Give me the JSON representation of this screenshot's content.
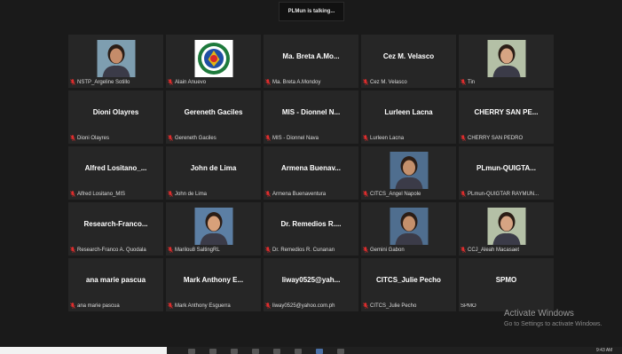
{
  "banner": "PLMun is talking...",
  "tiles": [
    {
      "name": "",
      "label": "NSTP_Argeline Sotillo",
      "avatar": "person-photo"
    },
    {
      "name": "",
      "label": "Alain Anuevo",
      "avatar": "seal-logo"
    },
    {
      "name": "Ma. Breta A.Mo...",
      "label": "Ma. Breta A.Mondoy",
      "avatar": ""
    },
    {
      "name": "Cez M. Velasco",
      "label": "Cez M. Velasco",
      "avatar": ""
    },
    {
      "name": "",
      "label": "Tin",
      "avatar": "person-photo"
    },
    {
      "name": "Dioni Olayres",
      "label": "Dioni Olayres",
      "avatar": ""
    },
    {
      "name": "Gereneth Gaciles",
      "label": "Gereneth Gaciles",
      "avatar": ""
    },
    {
      "name": "MIS - Dionnel N...",
      "label": "MIS - Dionnel Nava",
      "avatar": ""
    },
    {
      "name": "Lurleen Lacna",
      "label": "Lurleen Lacna",
      "avatar": ""
    },
    {
      "name": "CHERRY SAN PE...",
      "label": "CHERRY SAN PEDRO",
      "avatar": ""
    },
    {
      "name": "Alfred Lositano_...",
      "label": "Alfred Lositano_MIS",
      "avatar": ""
    },
    {
      "name": "John de Lima",
      "label": "John de Lima",
      "avatar": ""
    },
    {
      "name": "Armena Buenav...",
      "label": "Armena Buenaventura",
      "avatar": ""
    },
    {
      "name": "",
      "label": "CITCS_Angel Napole",
      "avatar": "person-photo"
    },
    {
      "name": "PLmun-QUIGTA...",
      "label": "PLmun-QUIGTAR RAYMUN...",
      "avatar": ""
    },
    {
      "name": "Research-Franco...",
      "label": "Research-Franco A. Quodala",
      "avatar": ""
    },
    {
      "name": "",
      "label": "Marilou8 SaltingRL",
      "avatar": "person-photo"
    },
    {
      "name": "Dr. Remedios R....",
      "label": "Dr. Remedios R. Cunanan",
      "avatar": ""
    },
    {
      "name": "",
      "label": "Gemini Gabon",
      "avatar": "person-photo"
    },
    {
      "name": "",
      "label": "CCJ_Aleah Macasaet",
      "avatar": "person-photo"
    },
    {
      "name": "ana marie pascua",
      "label": "ana marie pascua",
      "avatar": ""
    },
    {
      "name": "Mark Anthony E...",
      "label": "Mark Anthony Esguerra",
      "avatar": ""
    },
    {
      "name": "liway0525@yah...",
      "label": "liway0525@yahoo.com.ph",
      "avatar": ""
    },
    {
      "name": "CITCS_Julie Pecho",
      "label": "CITCS_Julie Pecho",
      "avatar": ""
    },
    {
      "name": "SPMO",
      "label": "SPMO",
      "avatar": ""
    }
  ],
  "tile_muted": [
    true,
    true,
    true,
    true,
    true,
    true,
    true,
    true,
    true,
    true,
    true,
    true,
    true,
    true,
    true,
    true,
    true,
    true,
    true,
    true,
    true,
    true,
    true,
    true,
    false
  ],
  "watermark": {
    "title": "Activate Windows",
    "subtitle": "Go to Settings to activate Windows."
  },
  "clock": "9:43 AM",
  "colors": {
    "background": "#1a1a1a",
    "tile": "#262626",
    "mic_muted": "#e02d2d"
  }
}
